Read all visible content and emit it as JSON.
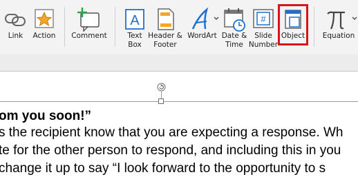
{
  "ribbon": {
    "link": "Link",
    "action": "Action",
    "comment": "Comment",
    "text_box": "Text\nBox",
    "header_footer": "Header &\nFooter",
    "wordart": "WordArt",
    "date_time": "Date &\nTime",
    "slide_number": "Slide\nNumber",
    "object": "Object",
    "equation": "Equation",
    "highlighted_item": "Object",
    "highlight_color": "#d9131a"
  },
  "document": {
    "lines": [
      "om you soon!”",
      "s the recipient know that you are expecting a response. Wh",
      "te for the other person to respond, and including this in you",
      "change it up to say “I look forward to the opportunity to s"
    ]
  }
}
